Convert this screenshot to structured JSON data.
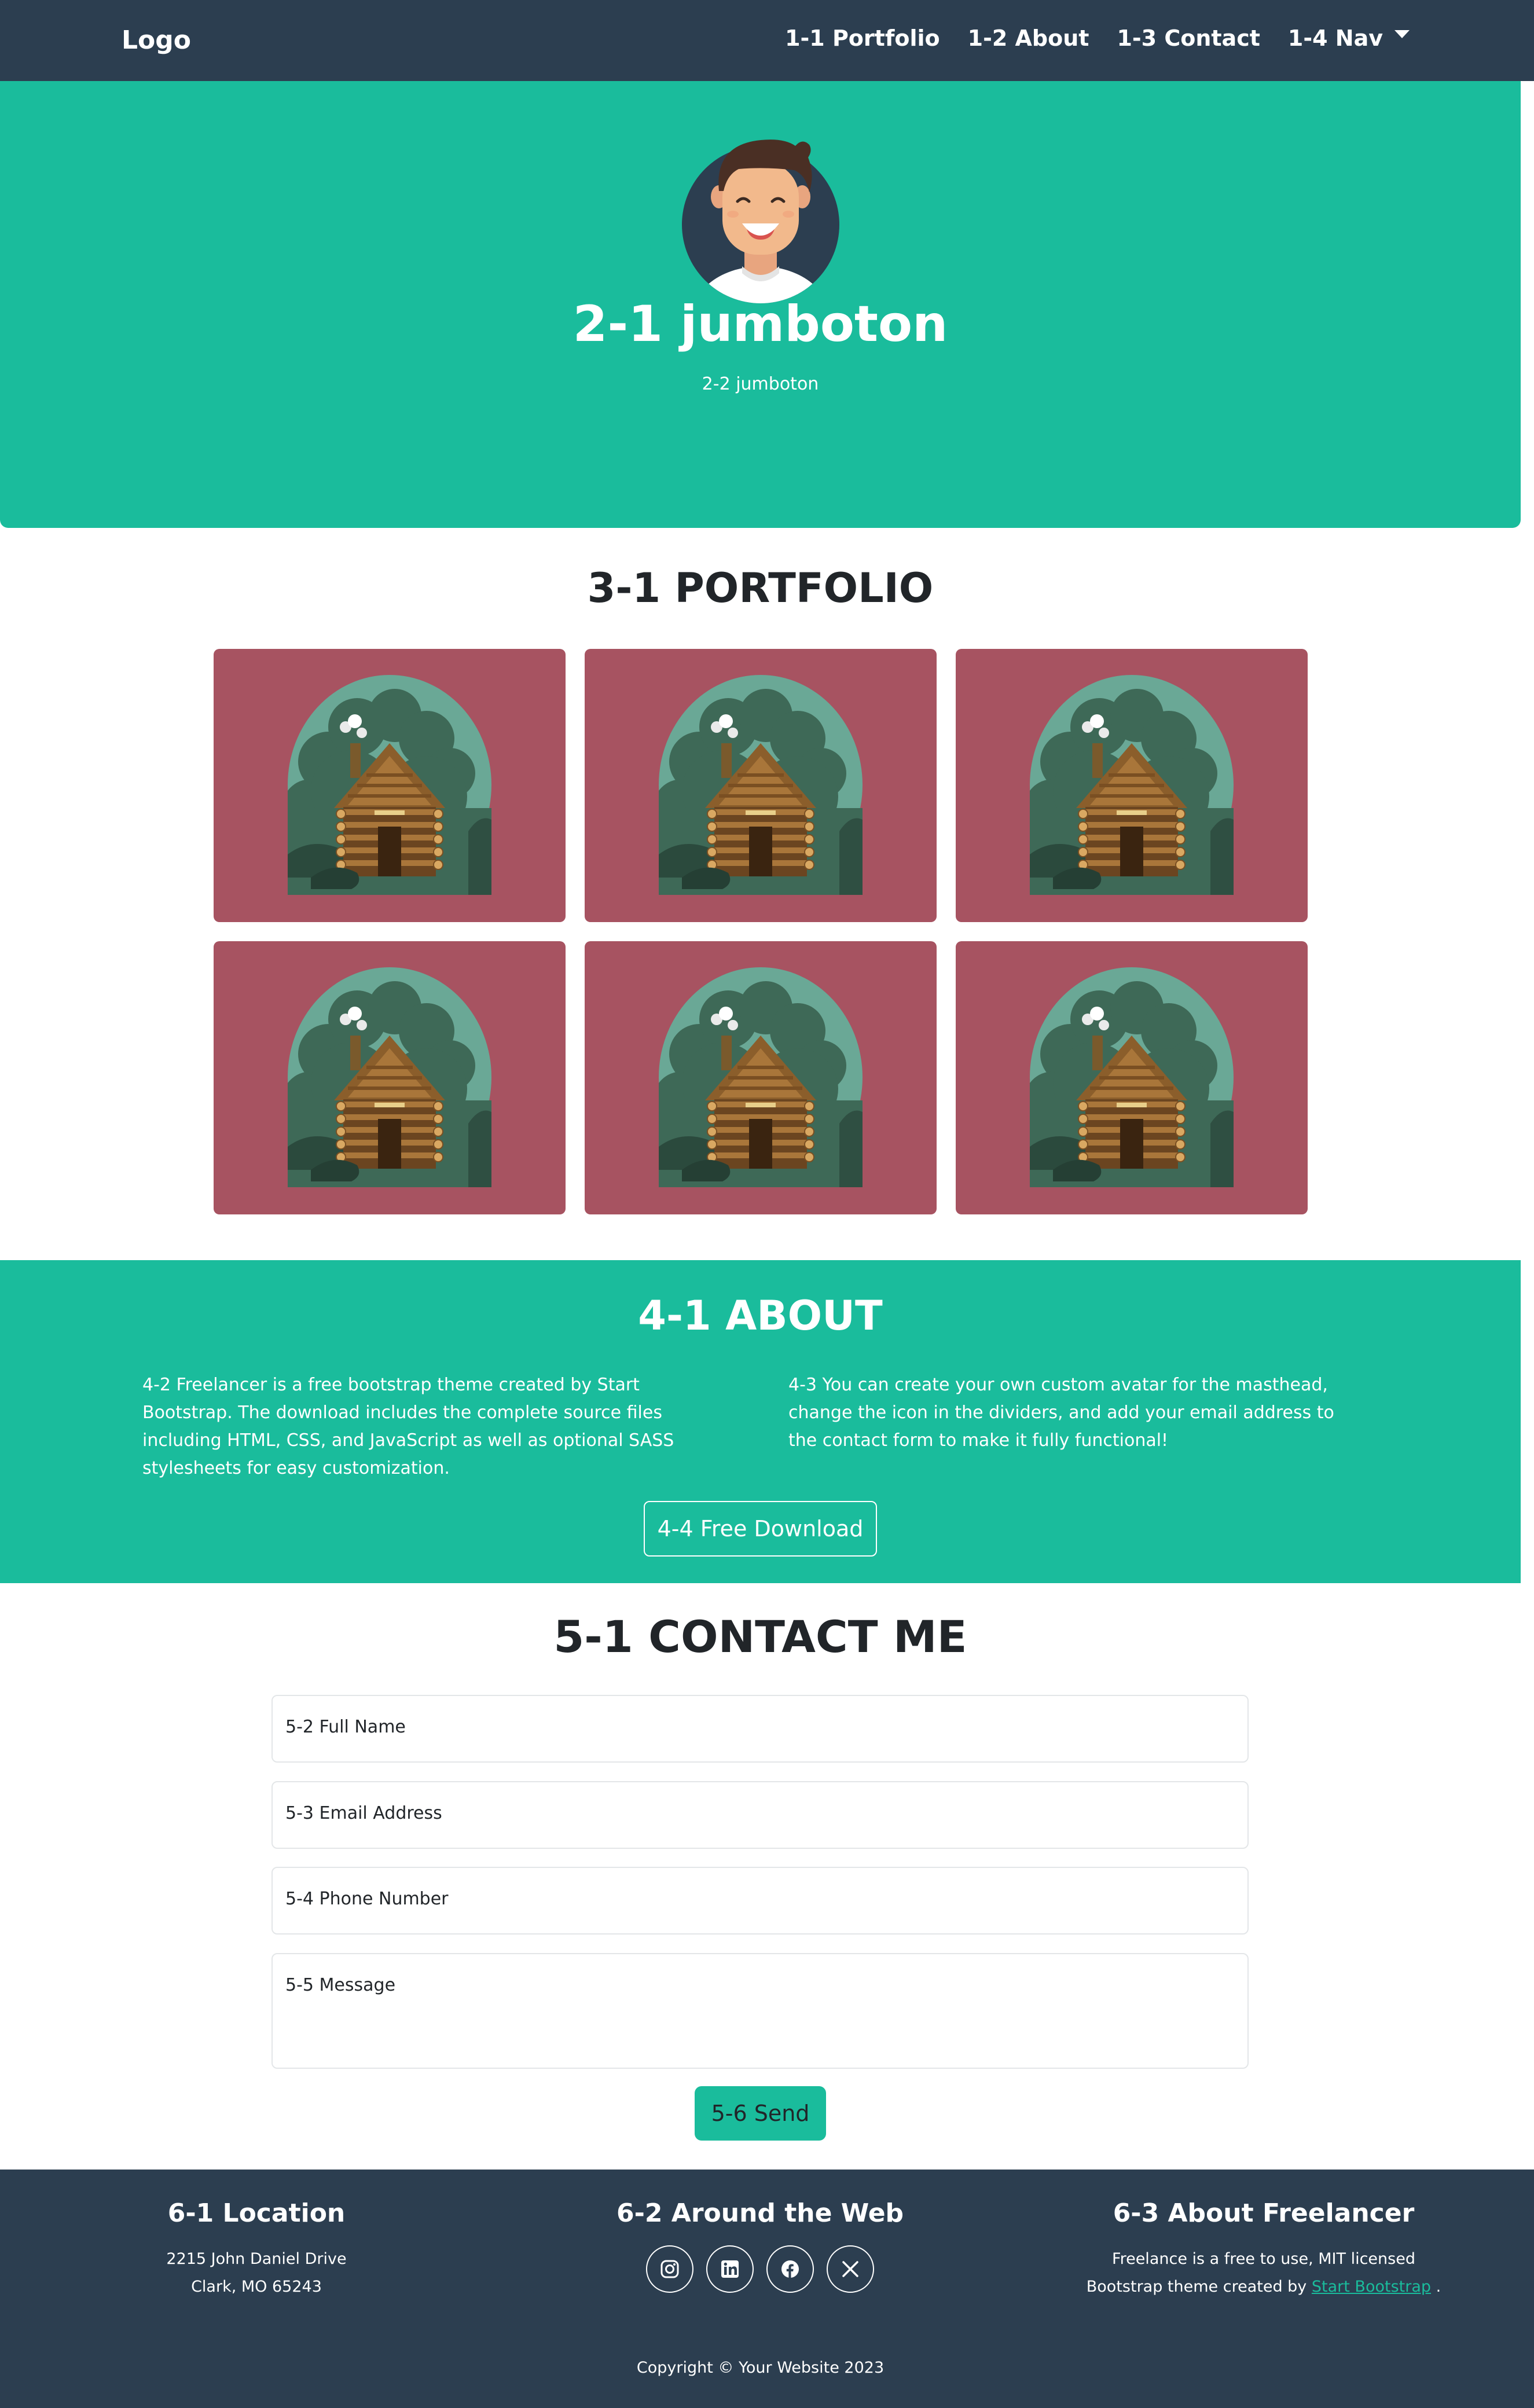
{
  "navbar": {
    "logo": "Logo",
    "items": [
      {
        "label": "1-1 Portfolio"
      },
      {
        "label": "1-2 About"
      },
      {
        "label": "1-3 Contact"
      },
      {
        "label": "1-4 Nav"
      }
    ]
  },
  "masthead": {
    "title": "2-1 jumboton",
    "subtitle": "2-2 jumboton"
  },
  "portfolio": {
    "title": "3-1 PORTFOLIO",
    "item_count": 6,
    "card_color": "#a75361",
    "icon": "log-cabin-icon"
  },
  "about": {
    "title": "4-1 ABOUT",
    "left_text": "4-2 Freelancer is a free bootstrap theme created by Start Bootstrap. The download includes the complete source files including HTML, CSS, and JavaScript as well as optional SASS stylesheets for easy customization.",
    "right_text": "4-3 You can create your own custom avatar for the masthead, change the icon in the dividers, and add your email address to the contact form to make it fully functional!",
    "button": "4-4 Free Download"
  },
  "contact": {
    "title": "5-1 CONTACT ME",
    "name_placeholder": "5-2 Full Name",
    "email_placeholder": "5-3 Email Address",
    "phone_placeholder": "5-4 Phone Number",
    "message_placeholder": "5-5 Message",
    "send": "5-6 Send"
  },
  "footer": {
    "location_title": "6-1 Location",
    "address_line1": "2215 John Daniel Drive",
    "address_line2": "Clark, MO 65243",
    "web_title": "6-2 Around the Web",
    "socials": [
      "instagram-icon",
      "linkedin-icon",
      "facebook-icon",
      "x-twitter-icon"
    ],
    "about_title": "6-3 About Freelancer",
    "about_line1": "Freelance is a free to use, MIT licensed",
    "about_line2": "Bootstrap theme created by",
    "about_link": "Start Bootstrap",
    "about_end": ".",
    "copyright": "Copyright © Your Website 2023"
  },
  "colors": {
    "primary": "#1abc9c",
    "dark": "#2c3e50",
    "card": "#a75361"
  }
}
